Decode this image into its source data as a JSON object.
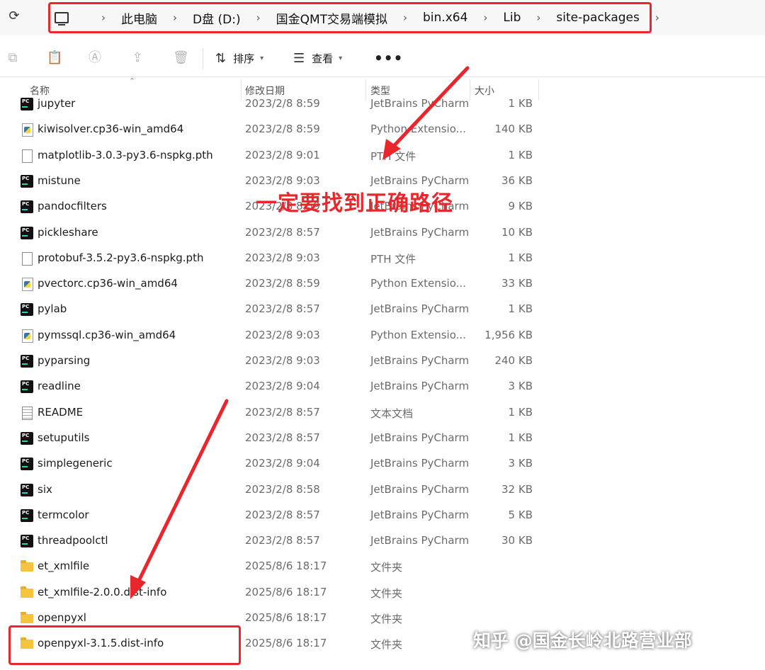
{
  "address_bar": {
    "refresh_icon": "refresh-icon",
    "breadcrumbs": [
      "此电脑",
      "D盘 (D:)",
      "国金QMT交易端模拟",
      "bin.x64",
      "Lib",
      "site-packages"
    ]
  },
  "toolbar": {
    "sort_label": "排序",
    "view_label": "查看",
    "more_label": "•••"
  },
  "columns": {
    "name": "名称",
    "date": "修改日期",
    "type": "类型",
    "size": "大小"
  },
  "files": [
    {
      "name": "jupyter",
      "date": "2023/2/8 8:59",
      "type": "JetBrains PyCharm",
      "size": "1 KB",
      "icon": "pycharm"
    },
    {
      "name": "kiwisolver.cp36-win_amd64",
      "date": "2023/2/8 8:59",
      "type": "Python Extensio...",
      "size": "140 KB",
      "icon": "pyd"
    },
    {
      "name": "matplotlib-3.0.3-py3.6-nspkg.pth",
      "date": "2023/2/8 9:01",
      "type": "PTH 文件",
      "size": "1 KB",
      "icon": "file"
    },
    {
      "name": "mistune",
      "date": "2023/2/8 9:03",
      "type": "JetBrains PyCharm",
      "size": "36 KB",
      "icon": "pycharm"
    },
    {
      "name": "pandocfilters",
      "date": "2023/2/8 8:59",
      "type": "JetBrains PyCharm",
      "size": "9 KB",
      "icon": "pycharm"
    },
    {
      "name": "pickleshare",
      "date": "2023/2/8 8:57",
      "type": "JetBrains PyCharm",
      "size": "10 KB",
      "icon": "pycharm"
    },
    {
      "name": "protobuf-3.5.2-py3.6-nspkg.pth",
      "date": "2023/2/8 9:03",
      "type": "PTH 文件",
      "size": "1 KB",
      "icon": "file"
    },
    {
      "name": "pvectorc.cp36-win_amd64",
      "date": "2023/2/8 8:59",
      "type": "Python Extensio...",
      "size": "33 KB",
      "icon": "pyd"
    },
    {
      "name": "pylab",
      "date": "2023/2/8 8:57",
      "type": "JetBrains PyCharm",
      "size": "1 KB",
      "icon": "pycharm"
    },
    {
      "name": "pymssql.cp36-win_amd64",
      "date": "2023/2/8 9:03",
      "type": "Python Extensio...",
      "size": "1,956 KB",
      "icon": "pyd"
    },
    {
      "name": "pyparsing",
      "date": "2023/2/8 9:03",
      "type": "JetBrains PyCharm",
      "size": "240 KB",
      "icon": "pycharm"
    },
    {
      "name": "readline",
      "date": "2023/2/8 9:04",
      "type": "JetBrains PyCharm",
      "size": "3 KB",
      "icon": "pycharm"
    },
    {
      "name": "README",
      "date": "2023/2/8 8:57",
      "type": "文本文档",
      "size": "1 KB",
      "icon": "txt"
    },
    {
      "name": "setuputils",
      "date": "2023/2/8 8:57",
      "type": "JetBrains PyCharm",
      "size": "1 KB",
      "icon": "pycharm"
    },
    {
      "name": "simplegeneric",
      "date": "2023/2/8 9:04",
      "type": "JetBrains PyCharm",
      "size": "3 KB",
      "icon": "pycharm"
    },
    {
      "name": "six",
      "date": "2023/2/8 8:58",
      "type": "JetBrains PyCharm",
      "size": "32 KB",
      "icon": "pycharm"
    },
    {
      "name": "termcolor",
      "date": "2023/2/8 8:57",
      "type": "JetBrains PyCharm",
      "size": "5 KB",
      "icon": "pycharm"
    },
    {
      "name": "threadpoolctl",
      "date": "2023/2/8 8:57",
      "type": "JetBrains PyCharm",
      "size": "30 KB",
      "icon": "pycharm"
    },
    {
      "name": "et_xmlfile",
      "date": "2025/8/6 18:17",
      "type": "文件夹",
      "size": "",
      "icon": "folder"
    },
    {
      "name": "et_xmlfile-2.0.0.dist-info",
      "date": "2025/8/6 18:17",
      "type": "文件夹",
      "size": "",
      "icon": "folder"
    },
    {
      "name": "openpyxl",
      "date": "2025/8/6 18:17",
      "type": "文件夹",
      "size": "",
      "icon": "folder"
    },
    {
      "name": "openpyxl-3.1.5.dist-info",
      "date": "2025/8/6 18:17",
      "type": "文件夹",
      "size": "",
      "icon": "folder"
    }
  ],
  "annotation": {
    "text": "一定要找到正确路径",
    "color": "#e8262b"
  },
  "watermark": "知乎 @国金长岭北路营业部"
}
